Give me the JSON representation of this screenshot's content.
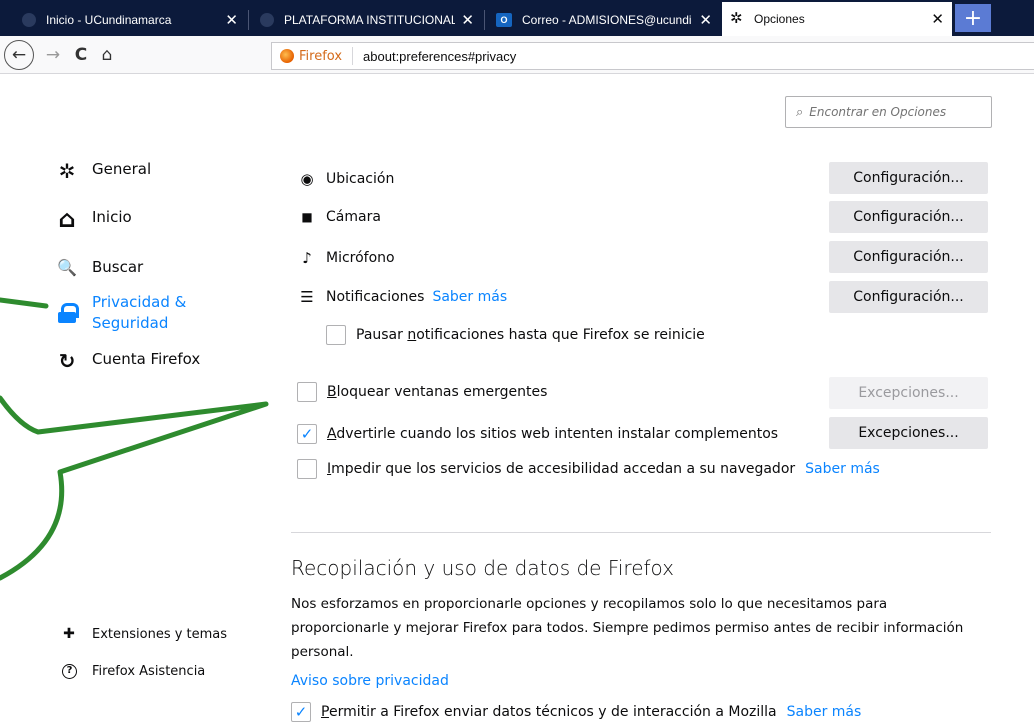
{
  "tabs": [
    {
      "title": "Inicio - UCundinamarca",
      "close": "✕"
    },
    {
      "title": "PLATAFORMA INSTITUCIONAL",
      "close": "✕"
    },
    {
      "title": "Correo - ADMISIONES@ucundi",
      "close": "✕"
    },
    {
      "title": "Opciones",
      "close": "✕"
    }
  ],
  "new_tab": "+",
  "nav": {
    "back_icon": "←",
    "forward_icon": "→",
    "reload_icon": "C",
    "home_icon": "⌂",
    "identity_label": "Firefox",
    "url": "about:preferences#privacy"
  },
  "search": {
    "placeholder": "Encontrar en Opciones",
    "icon": "⌕"
  },
  "categories": [
    {
      "label": "General",
      "icon": "✲"
    },
    {
      "label": "Inicio",
      "icon": "⌂"
    },
    {
      "label": "Buscar",
      "icon": "🔍"
    },
    {
      "label_line1": "Privacidad &",
      "label_line2": "Seguridad"
    },
    {
      "label": "Cuenta Firefox",
      "icon": "↻"
    }
  ],
  "footer": [
    {
      "label": "Extensiones y temas",
      "icon": "✚"
    },
    {
      "label": "Firefox Asistencia",
      "icon": "?"
    }
  ],
  "permissions": [
    {
      "label": "Ubicación",
      "icon": "◉",
      "button": "Configuración..."
    },
    {
      "label": "Cámara",
      "icon": "■",
      "button": "Configuración..."
    },
    {
      "label": "Micrófono",
      "icon": "♪",
      "button": "Configuración..."
    },
    {
      "label": "Notificaciones",
      "icon": "☰",
      "link": "Saber más",
      "button": "Configuración..."
    }
  ],
  "pause_notifications": {
    "pre": "Pausar ",
    "u": "n",
    "post": "otificaciones hasta que Firefox se reinicie",
    "checked": false
  },
  "block_popups": {
    "u": "B",
    "post": "loquear ventanas emergentes",
    "checked": false,
    "button": "Excepciones..."
  },
  "warn_addons": {
    "u": "A",
    "post": "dvertirle cuando los sitios web intenten instalar complementos",
    "checked": true,
    "button": "Excepciones..."
  },
  "accessibility": {
    "u": "I",
    "post": "mpedir que los servicios de accesibilidad accedan a su navegador",
    "link": "Saber más",
    "checked": false
  },
  "data_collection": {
    "heading": "Recopilación y uso de datos de Firefox",
    "description": "Nos esforzamos en proporcionarle opciones y recopilamos solo lo que necesitamos para proporcionarle y mejorar Firefox para todos. Siempre pedimos permiso antes de recibir información personal.",
    "privacy_link": "Aviso sobre privacidad",
    "telemetry": {
      "u": "P",
      "post": "ermitir a Firefox enviar datos técnicos y de interacción a Mozilla",
      "link": "Saber más",
      "checked": true
    }
  },
  "colors": {
    "accent": "#0a84ff",
    "tabstrip": "#0c1a3b",
    "callout": "#2e8b2e"
  },
  "check_mark": "✓"
}
